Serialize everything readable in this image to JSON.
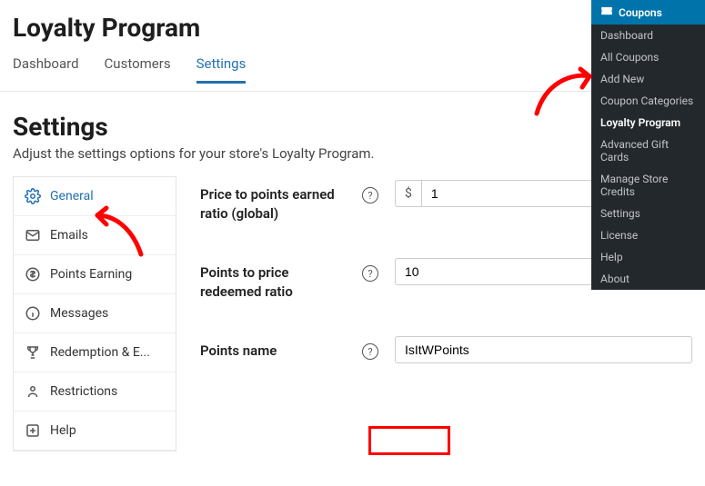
{
  "page_title": "Loyalty Program",
  "top_tabs": [
    {
      "label": "Dashboard",
      "active": false
    },
    {
      "label": "Customers",
      "active": false
    },
    {
      "label": "Settings",
      "active": true
    }
  ],
  "settings": {
    "heading": "Settings",
    "subtext": "Adjust the settings options for your store's Loyalty Program."
  },
  "sidebar": {
    "items": [
      {
        "label": "General",
        "icon": "gear",
        "active": true
      },
      {
        "label": "Emails",
        "icon": "mail",
        "active": false
      },
      {
        "label": "Points Earning",
        "icon": "dollar",
        "active": false
      },
      {
        "label": "Messages",
        "icon": "info",
        "active": false
      },
      {
        "label": "Redemption & E...",
        "icon": "trophy",
        "active": false
      },
      {
        "label": "Restrictions",
        "icon": "person",
        "active": false
      },
      {
        "label": "Help",
        "icon": "plus-box",
        "active": false
      }
    ]
  },
  "form": {
    "price_points": {
      "label": "Price to points earned ratio (global)",
      "prefix": "$",
      "value": "1"
    },
    "points_price": {
      "label": "Points to price redeemed ratio",
      "value": "10"
    },
    "points_name": {
      "label": "Points name",
      "value": "IsItWPoints"
    }
  },
  "help_glyph": "?",
  "admin_menu": {
    "header": "Coupons",
    "items": [
      "Dashboard",
      "All Coupons",
      "Add New",
      "Coupon Categories",
      "Loyalty Program",
      "Advanced Gift Cards",
      "Manage Store Credits",
      "Settings",
      "License",
      "Help",
      "About"
    ],
    "active_index": 4
  }
}
